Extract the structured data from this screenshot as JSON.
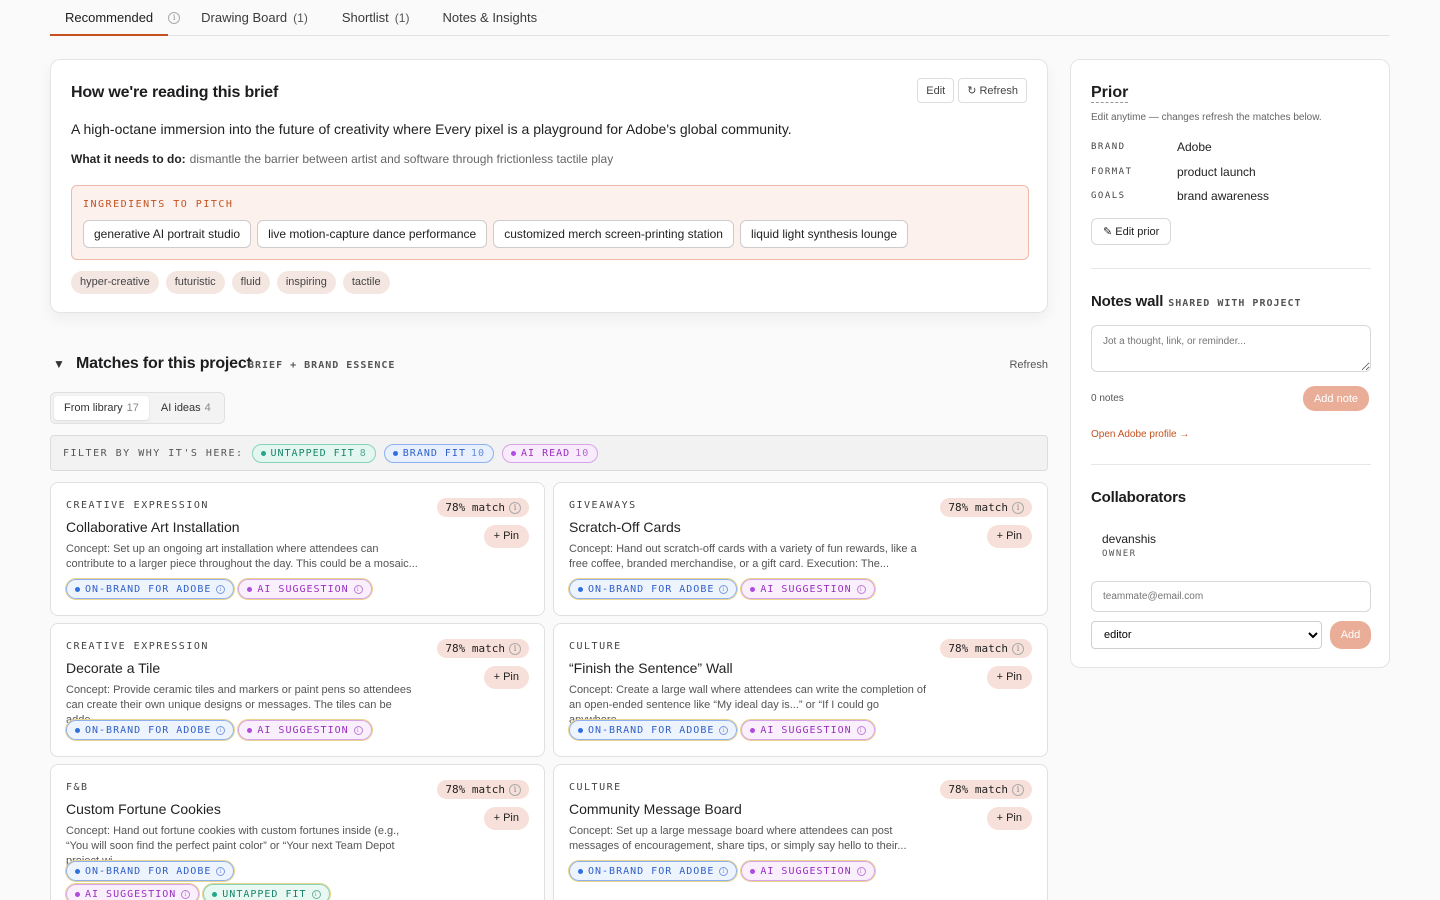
{
  "tabs": [
    {
      "label": "Recommended",
      "count": ""
    },
    {
      "label": "Drawing Board",
      "count": "(1)"
    },
    {
      "label": "Shortlist",
      "count": "(1)"
    },
    {
      "label": "Notes & Insights",
      "count": ""
    }
  ],
  "brief": {
    "title": "How we're reading this brief",
    "edit_label": "Edit",
    "refresh_label": "↻ Refresh",
    "description": "A high-octane immersion into the future of creativity where Every pixel is a playground for Adobe's global community.",
    "need_label": "What it needs to do:",
    "need_text": "dismantle the barrier between artist and software through frictionless tactile play",
    "ingredients_label": "INGREDIENTS TO PITCH",
    "ingredients": [
      "generative AI portrait studio",
      "live motion-capture dance performance",
      "customized merch screen-printing station",
      "liquid light synthesis lounge"
    ],
    "tones": [
      "hyper-creative",
      "futuristic",
      "fluid",
      "inspiring",
      "tactile"
    ]
  },
  "matches": {
    "toggle": "▼",
    "title": "Matches for this project",
    "subtitle": "BRIEF + BRAND ESSENCE",
    "refresh_label": "Refresh",
    "segments": [
      {
        "label": "From library",
        "count": "17"
      },
      {
        "label": "AI ideas",
        "count": "4"
      }
    ],
    "filter_label": "FILTER BY WHY IT'S HERE:",
    "filters": [
      {
        "label": "UNTAPPED FIT",
        "count": "8"
      },
      {
        "label": "BRAND FIT",
        "count": "10"
      },
      {
        "label": "AI READ",
        "count": "10"
      }
    ],
    "match_label": "78% match",
    "pin_label": "+ Pin",
    "badge_brand": "ON-BRAND FOR ADOBE",
    "badge_ai": "AI SUGGESTION",
    "badge_untapped": "UNTAPPED FIT",
    "cards": [
      {
        "category": "CREATIVE EXPRESSION",
        "title": "Collaborative Art Installation",
        "concept": "Concept: Set up an ongoing art installation where attendees can contribute to a larger piece throughout the day. This could be a mosaic..."
      },
      {
        "category": "GIVEAWAYS",
        "title": "Scratch-Off Cards",
        "concept": "Concept: Hand out scratch-off cards with a variety of fun rewards, like a free coffee, branded merchandise, or a gift card. Execution: The..."
      },
      {
        "category": "CREATIVE EXPRESSION",
        "title": "Decorate a Tile",
        "concept": "Concept: Provide ceramic tiles and markers or paint pens so attendees can create their own unique designs or messages. The tiles can be adde..."
      },
      {
        "category": "CULTURE",
        "title": "“Finish the Sentence” Wall",
        "concept": "Concept: Create a large wall where attendees can write the completion of an open-ended sentence like “My ideal day is...” or “If I could go anywhere..."
      },
      {
        "category": "F&B",
        "title": "Custom Fortune Cookies",
        "concept": "Concept: Hand out fortune cookies with custom fortunes inside (e.g., “You will soon find the perfect paint color” or “Your next Team Depot project wi..."
      },
      {
        "category": "CULTURE",
        "title": "Community Message Board",
        "concept": "Concept: Set up a large message board where attendees can post messages of encouragement, share tips, or simply say hello to their..."
      }
    ]
  },
  "prior": {
    "title": "Prior",
    "subtitle": "Edit anytime — changes refresh the matches below.",
    "rows": [
      {
        "key": "BRAND",
        "value": "Adobe"
      },
      {
        "key": "FORMAT",
        "value": "product launch"
      },
      {
        "key": "GOALS",
        "value": "brand awareness"
      }
    ],
    "edit_label": "✎ Edit prior"
  },
  "notes": {
    "title": "Notes wall",
    "subtitle": "SHARED WITH PROJECT",
    "placeholder": "Jot a thought, link, or reminder...",
    "count": "0 notes",
    "add_label": "Add note",
    "profile_link": "Open Adobe profile →"
  },
  "collaborators": {
    "title": "Collaborators",
    "name": "devanshis",
    "role": "OWNER",
    "email_placeholder": "teammate@email.com",
    "role_option": "editor",
    "add_label": "Add"
  },
  "colors": {
    "accent": "#c4511f",
    "brand_badge": "#2f5fc7",
    "ai_badge": "#9a2fbf",
    "untapped_badge": "#18856a"
  }
}
